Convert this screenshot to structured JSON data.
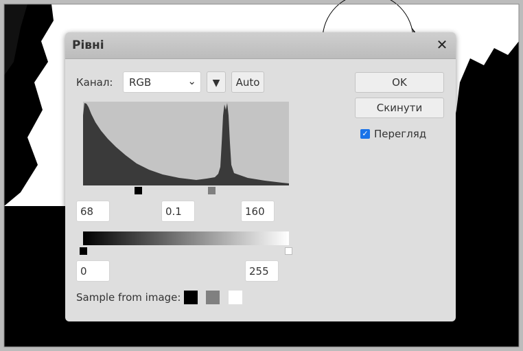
{
  "dialog": {
    "title": "Рівні",
    "close_symbol": "✕",
    "channel_label": "Канал:",
    "channel_value": "RGB",
    "channel_options": [
      "RGB"
    ],
    "dropdown_symbol": "▼",
    "auto_label": "Auto",
    "ok_label": "OK",
    "reset_label": "Скинути",
    "preview_label": "Перегляд",
    "preview_checked": true,
    "input_black": "68",
    "input_gamma": "0.1",
    "input_white": "160",
    "output_black": "0",
    "output_white": "255",
    "sample_label": "Sample from image:"
  },
  "colors": {
    "dialog_bg": "#dedede",
    "histogram_bg": "#c4c4c4",
    "histogram_fill": "#3a3a3a",
    "checkbox_accent": "#1a73e8"
  }
}
